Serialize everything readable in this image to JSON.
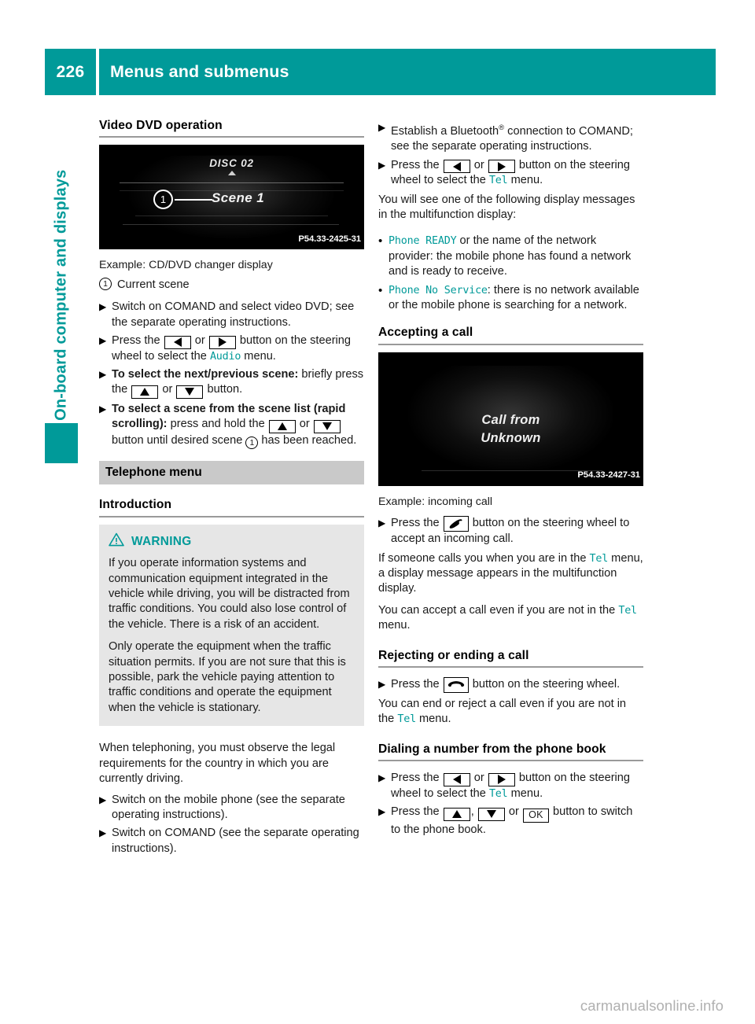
{
  "header": {
    "page_number": "226",
    "title": "Menus and submenus",
    "accent_color": "#009a99"
  },
  "sidebar": {
    "chapter_label": "On-board computer and displays",
    "tab_color": "#009a99"
  },
  "left_column": {
    "section_title": "Video DVD operation",
    "figure": {
      "disc_label": "DISC 02",
      "scene_label": "Scene 1",
      "callout_number": "1",
      "image_code": "P54.33-2425-31",
      "caption": "Example: CD/DVD changer display"
    },
    "legend": {
      "number": "1",
      "text": "Current scene"
    },
    "steps": [
      {
        "marker": "▶",
        "segments": [
          {
            "type": "text",
            "value": "Switch on COMAND and select video DVD; see the separate operating instructions."
          }
        ]
      },
      {
        "marker": "▶",
        "segments": [
          {
            "type": "text",
            "value": "Press the "
          },
          {
            "type": "button",
            "value": "arrow-left"
          },
          {
            "type": "text",
            "value": " or "
          },
          {
            "type": "button",
            "value": "arrow-right"
          },
          {
            "type": "text",
            "value": " button on the steering wheel to select the "
          },
          {
            "type": "mono",
            "value": "Audio"
          },
          {
            "type": "text",
            "value": " menu."
          }
        ]
      },
      {
        "marker": "▶",
        "segments": [
          {
            "type": "bold",
            "value": "To select the next/previous scene:"
          },
          {
            "type": "text",
            "value": " briefly press the "
          },
          {
            "type": "button",
            "value": "arrow-up"
          },
          {
            "type": "text",
            "value": " or "
          },
          {
            "type": "button",
            "value": "arrow-down"
          },
          {
            "type": "text",
            "value": " button."
          }
        ]
      },
      {
        "marker": "▶",
        "segments": [
          {
            "type": "bold",
            "value": "To select a scene from the scene list (rapid scrolling):"
          },
          {
            "type": "text",
            "value": " press and hold the "
          },
          {
            "type": "button",
            "value": "arrow-up"
          },
          {
            "type": "text",
            "value": " or "
          },
          {
            "type": "button",
            "value": "arrow-down"
          },
          {
            "type": "text",
            "value": " button until desired scene "
          },
          {
            "type": "circle",
            "value": "1"
          },
          {
            "type": "text",
            "value": " has been reached."
          }
        ]
      }
    ],
    "telephone_bar_heading": "Telephone menu",
    "introduction_heading": "Introduction",
    "warning": {
      "label": "WARNING",
      "icon": "warning-triangle-icon",
      "paragraphs": [
        "If you operate information systems and communication equipment integrated in the vehicle while driving, you will be distracted from traffic conditions. You could also lose control of the vehicle. There is a risk of an accident.",
        "Only operate the equipment when the traffic situation permits. If you are not sure that this is possible, park the vehicle paying attention to traffic conditions and operate the equipment when the vehicle is stationary."
      ]
    },
    "closing_paragraph": "When telephoning, you must observe the legal requirements for the country in which you are currently driving.",
    "closing_steps": [
      {
        "marker": "▶",
        "segments": [
          {
            "type": "text",
            "value": "Switch on the mobile phone (see the separate operating instructions)."
          }
        ]
      },
      {
        "marker": "▶",
        "segments": [
          {
            "type": "text",
            "value": "Switch on COMAND (see the separate operating instructions)."
          }
        ]
      }
    ]
  },
  "right_column": {
    "top_steps": [
      {
        "marker": "▶",
        "segments": [
          {
            "type": "text",
            "value": "Establish a Bluetooth"
          },
          {
            "type": "sup",
            "value": "®"
          },
          {
            "type": "text",
            "value": " connection to COMAND; see the separate operating instructions."
          }
        ]
      },
      {
        "marker": "▶",
        "segments": [
          {
            "type": "text",
            "value": "Press the "
          },
          {
            "type": "button",
            "value": "arrow-left"
          },
          {
            "type": "text",
            "value": " or "
          },
          {
            "type": "button",
            "value": "arrow-right"
          },
          {
            "type": "text",
            "value": " button on the steering wheel to select the "
          },
          {
            "type": "mono",
            "value": "Tel"
          },
          {
            "type": "text",
            "value": " menu."
          }
        ]
      }
    ],
    "messages_intro": "You will see one of the following display messages in the multifunction display:",
    "messages": [
      {
        "marker": "•",
        "segments": [
          {
            "type": "mono",
            "value": "Phone READY"
          },
          {
            "type": "text",
            "value": " or the name of the network provider: the mobile phone has found a network and is ready to receive."
          }
        ]
      },
      {
        "marker": "•",
        "segments": [
          {
            "type": "mono",
            "value": "Phone No Service"
          },
          {
            "type": "text",
            "value": ": there is no network available or the mobile phone is searching for a network."
          }
        ]
      }
    ],
    "accepting": {
      "heading": "Accepting a call",
      "figure": {
        "line1": "Call from",
        "line2": "Unknown",
        "image_code": "P54.33-2427-31",
        "caption": "Example: incoming call"
      },
      "steps": [
        {
          "marker": "▶",
          "segments": [
            {
              "type": "text",
              "value": "Press the "
            },
            {
              "type": "button",
              "value": "phone-accept"
            },
            {
              "type": "text",
              "value": " button on the steering wheel to accept an incoming call."
            }
          ]
        }
      ],
      "paragraphs": [
        [
          {
            "type": "text",
            "value": "If someone calls you when you are in the "
          },
          {
            "type": "mono",
            "value": "Tel"
          },
          {
            "type": "text",
            "value": " menu, a display message appears in the multifunction display."
          }
        ],
        [
          {
            "type": "text",
            "value": "You can accept a call even if you are not in the "
          },
          {
            "type": "mono",
            "value": "Tel"
          },
          {
            "type": "text",
            "value": " menu."
          }
        ]
      ]
    },
    "rejecting": {
      "heading": "Rejecting or ending a call",
      "steps": [
        {
          "marker": "▶",
          "segments": [
            {
              "type": "text",
              "value": "Press the "
            },
            {
              "type": "button",
              "value": "phone-end"
            },
            {
              "type": "text",
              "value": " button on the steering wheel."
            }
          ]
        }
      ],
      "paragraphs": [
        [
          {
            "type": "text",
            "value": "You can end or reject a call even if you are not in the "
          },
          {
            "type": "mono",
            "value": "Tel"
          },
          {
            "type": "text",
            "value": " menu."
          }
        ]
      ]
    },
    "dialing": {
      "heading": "Dialing a number from the phone book",
      "steps": [
        {
          "marker": "▶",
          "segments": [
            {
              "type": "text",
              "value": "Press the "
            },
            {
              "type": "button",
              "value": "arrow-left"
            },
            {
              "type": "text",
              "value": " or "
            },
            {
              "type": "button",
              "value": "arrow-right"
            },
            {
              "type": "text",
              "value": " button on the steering wheel to select the "
            },
            {
              "type": "mono",
              "value": "Tel"
            },
            {
              "type": "text",
              "value": " menu."
            }
          ]
        },
        {
          "marker": "▶",
          "segments": [
            {
              "type": "text",
              "value": "Press the "
            },
            {
              "type": "button",
              "value": "arrow-up"
            },
            {
              "type": "text",
              "value": ", "
            },
            {
              "type": "button",
              "value": "arrow-down"
            },
            {
              "type": "text",
              "value": " or "
            },
            {
              "type": "button",
              "value": "ok"
            },
            {
              "type": "text",
              "value": " button to switch to the phone book."
            }
          ]
        }
      ]
    }
  },
  "footer": {
    "watermark": "carmanualsonline.info"
  },
  "button_labels": {
    "ok": "OK"
  }
}
